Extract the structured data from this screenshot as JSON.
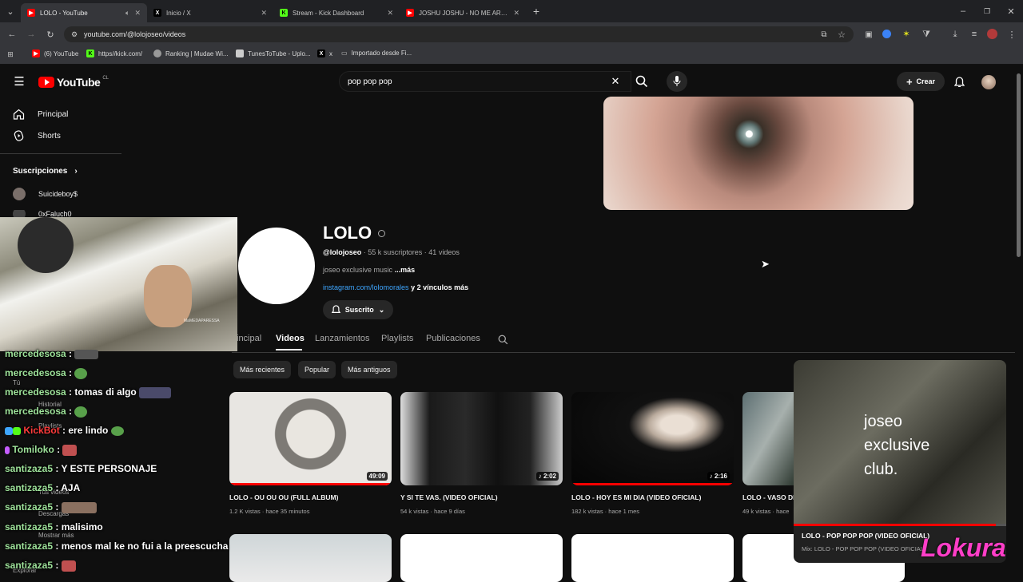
{
  "browser": {
    "tabs": [
      {
        "label": "LOLO - YouTube",
        "favicon": "youtube-icon",
        "active": true
      },
      {
        "label": "Inicio / X",
        "favicon": "x-icon",
        "active": false
      },
      {
        "label": "Stream - Kick Dashboard",
        "favicon": "kick-icon",
        "active": false
      },
      {
        "label": "JOSHU JOSHU - NO ME ARREP",
        "favicon": "youtube-icon",
        "active": false
      }
    ],
    "url": "youtube.com/@lolojoseo/videos",
    "bookmarks": [
      "(6) YouTube",
      "https//kick.com/",
      "Ranking | Mudae Wi...",
      "TunesToTube - Uplo...",
      "x",
      "Importado desde Fi..."
    ]
  },
  "youtube": {
    "logo": "YouTube",
    "region": "CL",
    "search_value": "pop pop pop",
    "create_label": "Crear",
    "nav": [
      {
        "label": "Principal",
        "icon": "home-icon"
      },
      {
        "label": "Shorts",
        "icon": "shorts-icon"
      }
    ],
    "subscriptions_title": "Suscripciones",
    "subscriptions": [
      "Suicideboy$",
      "0xFaluch0"
    ],
    "sidebar_under": [
      "Tú",
      "Historial",
      "Playlists",
      "Tus videos",
      "Descargas",
      "Mostrar más",
      "Explorar"
    ],
    "channel": {
      "name": "LOLO",
      "handle": "@lolojoseo",
      "stats": "55 k suscriptores · 41 videos",
      "description": "joseo exclusive music",
      "more": "...más",
      "link": "instagram.com/lolomorales",
      "link_more": "y 2 vínculos más",
      "subscribed_label": "Suscrito"
    },
    "tabs": [
      "incipal",
      "Videos",
      "Lanzamientos",
      "Playlists",
      "Publicaciones"
    ],
    "active_tab": "Videos",
    "chips": [
      "Más recientes",
      "Popular",
      "Más antiguos"
    ],
    "videos": [
      {
        "title": "LOLO - OU OU OU (FULL ALBUM)",
        "meta": "1.2 K vistas · hace 35 minutos",
        "duration": "49:09"
      },
      {
        "title": "Y SI TE VAS. (VIDEO OFICIAL)",
        "meta": "54 k vistas · hace 9 días",
        "duration": "2:02"
      },
      {
        "title": "LOLO - HOY ES MI DIA (VIDEO OFICIAL)",
        "meta": "182 k vistas · hace 1 mes",
        "duration": "2:16"
      },
      {
        "title": "LOLO - VASO DI",
        "meta": "49 k vistas · hace",
        "duration": ""
      }
    ],
    "miniplayer": {
      "overlay_text": [
        "joseo",
        "exclusive",
        "club."
      ],
      "title": "LOLO - POP POP POP (VIDEO OFICIAL)",
      "subtitle": "Mix: LOLO - POP POP POP (VIDEO OFICIAL)",
      "progress": 0.95
    }
  },
  "overlay": {
    "webcam_watermark": "MaMEDAPARESSA",
    "brand_text": "Lokura",
    "chat": [
      {
        "user": "mercedesosa",
        "text": ""
      },
      {
        "user": "mercedesosa",
        "text": ""
      },
      {
        "user": "mercedesosa",
        "text": "tomas di algo"
      },
      {
        "user": "mercedesosa",
        "text": ""
      },
      {
        "user": "KickBot",
        "text": "ere lindo"
      },
      {
        "user": "Tomiloko",
        "text": ""
      },
      {
        "user": "santizaza5",
        "text": "Y ESTE PERSONAJE"
      },
      {
        "user": "santizaza5",
        "text": "AJA"
      },
      {
        "user": "santizaza5",
        "text": ""
      },
      {
        "user": "santizaza5",
        "text": "malisimo"
      },
      {
        "user": "santizaza5",
        "text": "menos mal ke no fui a la preescucha"
      },
      {
        "user": "santizaza5",
        "text": ""
      }
    ]
  },
  "colors": {
    "youtube_red": "#ff0000",
    "kick_green": "#53fc18",
    "link_blue": "#3ea6ff",
    "chat_user": "#9ee29a",
    "brand_pink": "#ff3ec8"
  }
}
